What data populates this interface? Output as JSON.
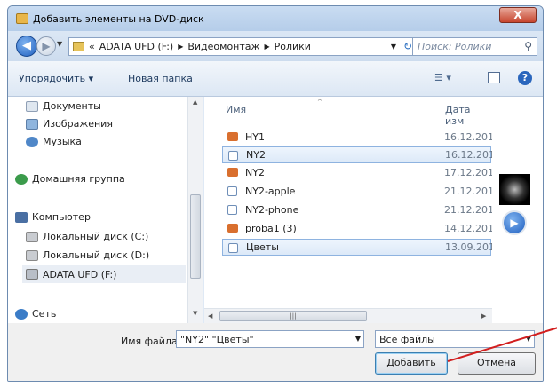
{
  "window": {
    "title": "Добавить элементы на DVD-диск",
    "close_glyph": "X"
  },
  "address": {
    "crumb_overflow": "«",
    "crumbs": [
      "ADATA UFD (F:)",
      "Видеомонтаж",
      "Ролики"
    ],
    "search_placeholder": "Поиск: Ролики"
  },
  "toolbar": {
    "organize_label": "Упорядочить ▾",
    "new_folder_label": "Новая папка"
  },
  "sidebar": {
    "items": [
      {
        "label": "Документы",
        "icon": "documents-icon"
      },
      {
        "label": "Изображения",
        "icon": "pictures-icon"
      },
      {
        "label": "Музыка",
        "icon": "music-icon"
      },
      {
        "label": "Домашняя группа",
        "icon": "homegroup-icon"
      },
      {
        "label": "Компьютер",
        "icon": "computer-icon"
      },
      {
        "label": "Локальный диск (C:)",
        "icon": "drive-icon"
      },
      {
        "label": "Локальный диск (D:)",
        "icon": "drive-icon"
      },
      {
        "label": "ADATA UFD (F:)",
        "icon": "usb-drive-icon"
      },
      {
        "label": "Сеть",
        "icon": "network-icon"
      }
    ]
  },
  "file_list": {
    "columns": [
      "Имя",
      "Дата изм"
    ],
    "rows": [
      {
        "name": "HY1",
        "date": "16.12.201",
        "icon": "video-project-icon",
        "selected": false
      },
      {
        "name": "NY2",
        "date": "16.12.201",
        "icon": "video-file-icon",
        "selected": true
      },
      {
        "name": "NY2",
        "date": "17.12.201",
        "icon": "video-project-icon",
        "selected": false
      },
      {
        "name": "NY2-apple",
        "date": "21.12.201",
        "icon": "video-file-icon",
        "selected": false
      },
      {
        "name": "NY2-phone",
        "date": "21.12.201",
        "icon": "video-file-icon",
        "selected": false
      },
      {
        "name": "proba1 (3)",
        "date": "14.12.201",
        "icon": "video-project-icon",
        "selected": false
      },
      {
        "name": "Цветы",
        "date": "13.09.201",
        "icon": "video-file-icon",
        "selected": true
      }
    ]
  },
  "bottom": {
    "filename_label": "Имя файла:",
    "filename_value": "\"NY2\" \"Цветы\"",
    "filetype_value": "Все файлы",
    "add_label": "Добавить",
    "cancel_label": "Отмена"
  },
  "colors": {
    "selection_border": "#8eb3e0",
    "accent_blue": "#2a66bd",
    "annotation_red": "#d21f1f"
  }
}
